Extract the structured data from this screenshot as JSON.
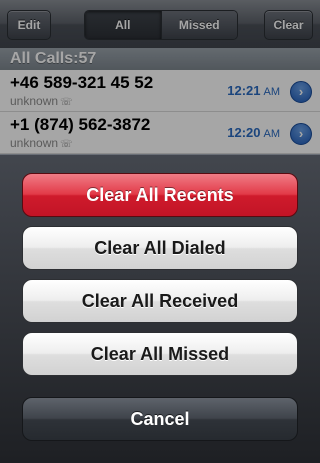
{
  "navbar": {
    "edit_label": "Edit",
    "segments": [
      "All",
      "Missed"
    ],
    "selected_segment": "All",
    "clear_label": "Clear"
  },
  "section": {
    "title": "All Calls:57"
  },
  "calls": [
    {
      "number": "+46 589-321 45 52",
      "label": "unknown",
      "time": "12:21",
      "ampm": "AM"
    },
    {
      "number": "+1 (874) 562-3872",
      "label": "unknown",
      "time": "12:20",
      "ampm": "AM"
    }
  ],
  "action_sheet": {
    "destructive_label": "Clear All Recents",
    "options": [
      "Clear All Dialed",
      "Clear All Received",
      "Clear All Missed"
    ],
    "cancel_label": "Cancel"
  },
  "icons": {
    "call_type": "phone-icon",
    "disclosure": "info-disclosure-icon"
  },
  "colors": {
    "destructive": "#d8202f",
    "time_text": "#2a6ac0",
    "disclosure": "#2f6fd0"
  }
}
